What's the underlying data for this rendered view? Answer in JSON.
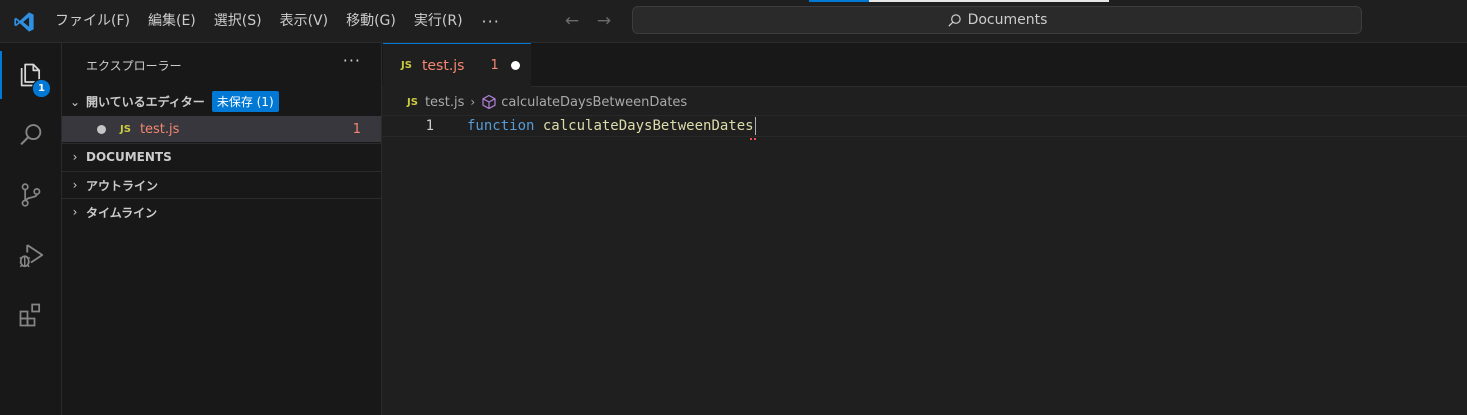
{
  "titlebar": {
    "menu": [
      "ファイル(F)",
      "編集(E)",
      "選択(S)",
      "表示(V)",
      "移動(G)",
      "実行(R)"
    ],
    "more": "···",
    "back": "←",
    "forward": "→",
    "search_text": "Documents"
  },
  "activity": {
    "explorer_badge": "1"
  },
  "sidebar": {
    "title": "エクスプローラー",
    "more": "···",
    "open_editors": {
      "label": "開いているエディター",
      "badge": "未保存 (1)",
      "files": [
        {
          "icon": "JS",
          "name": "test.js",
          "count": "1"
        }
      ]
    },
    "sections": [
      "DOCUMENTS",
      "アウトライン",
      "タイムライン"
    ]
  },
  "editor": {
    "tab": {
      "icon": "JS",
      "name": "test.js",
      "count": "1"
    },
    "breadcrumb": {
      "icon": "JS",
      "file": "test.js",
      "symbol": "calculateDaysBetweenDates"
    },
    "lines": [
      {
        "number": "1",
        "keyword": "function",
        "identifier": "calculateDaysBetweenDates"
      }
    ]
  },
  "colors": {
    "accent": "#0078d4",
    "error": "#f48771",
    "keyword": "#569cd6",
    "function": "#dcdcaa",
    "js_icon": "#cbcb41"
  }
}
